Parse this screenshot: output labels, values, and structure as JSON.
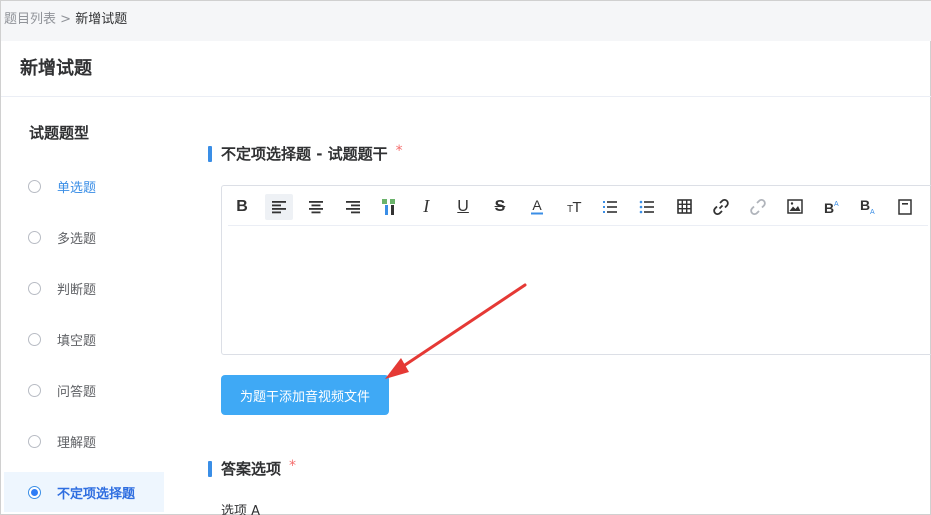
{
  "breadcrumb": {
    "parent": "题目列表",
    "separator": " > ",
    "current": "新增试题"
  },
  "page_title": "新增试题",
  "sidebar": {
    "title": "试题题型",
    "items": [
      {
        "label": "单选题",
        "state": "hover"
      },
      {
        "label": "多选题",
        "state": "normal"
      },
      {
        "label": "判断题",
        "state": "normal"
      },
      {
        "label": "填空题",
        "state": "normal"
      },
      {
        "label": "问答题",
        "state": "normal"
      },
      {
        "label": "理解题",
        "state": "normal"
      },
      {
        "label": "不定项选择题",
        "state": "selected"
      }
    ]
  },
  "stem_section": {
    "title": "不定项选择题 - 试题题干",
    "required_mark": "*"
  },
  "editor": {
    "tools": [
      "bold-icon",
      "align-left-icon",
      "align-center-icon",
      "align-right-icon",
      "indent-icon",
      "italic-icon",
      "underline-icon",
      "strikethrough-icon",
      "font-color-icon",
      "font-size-icon",
      "ordered-list-icon",
      "unordered-list-icon",
      "table-icon",
      "link-icon",
      "unlink-icon",
      "image-icon",
      "superscript-icon",
      "subscript-icon",
      "more-icon"
    ],
    "content": ""
  },
  "upload_button": {
    "label": "为题干添加音视频文件"
  },
  "answer_section": {
    "title": "答案选项",
    "required_mark": "*"
  },
  "options": [
    {
      "label": "选项 A"
    }
  ],
  "colors": {
    "accent": "#3fa9f5",
    "required": "#f56c6c",
    "arrow": "#e53935"
  }
}
